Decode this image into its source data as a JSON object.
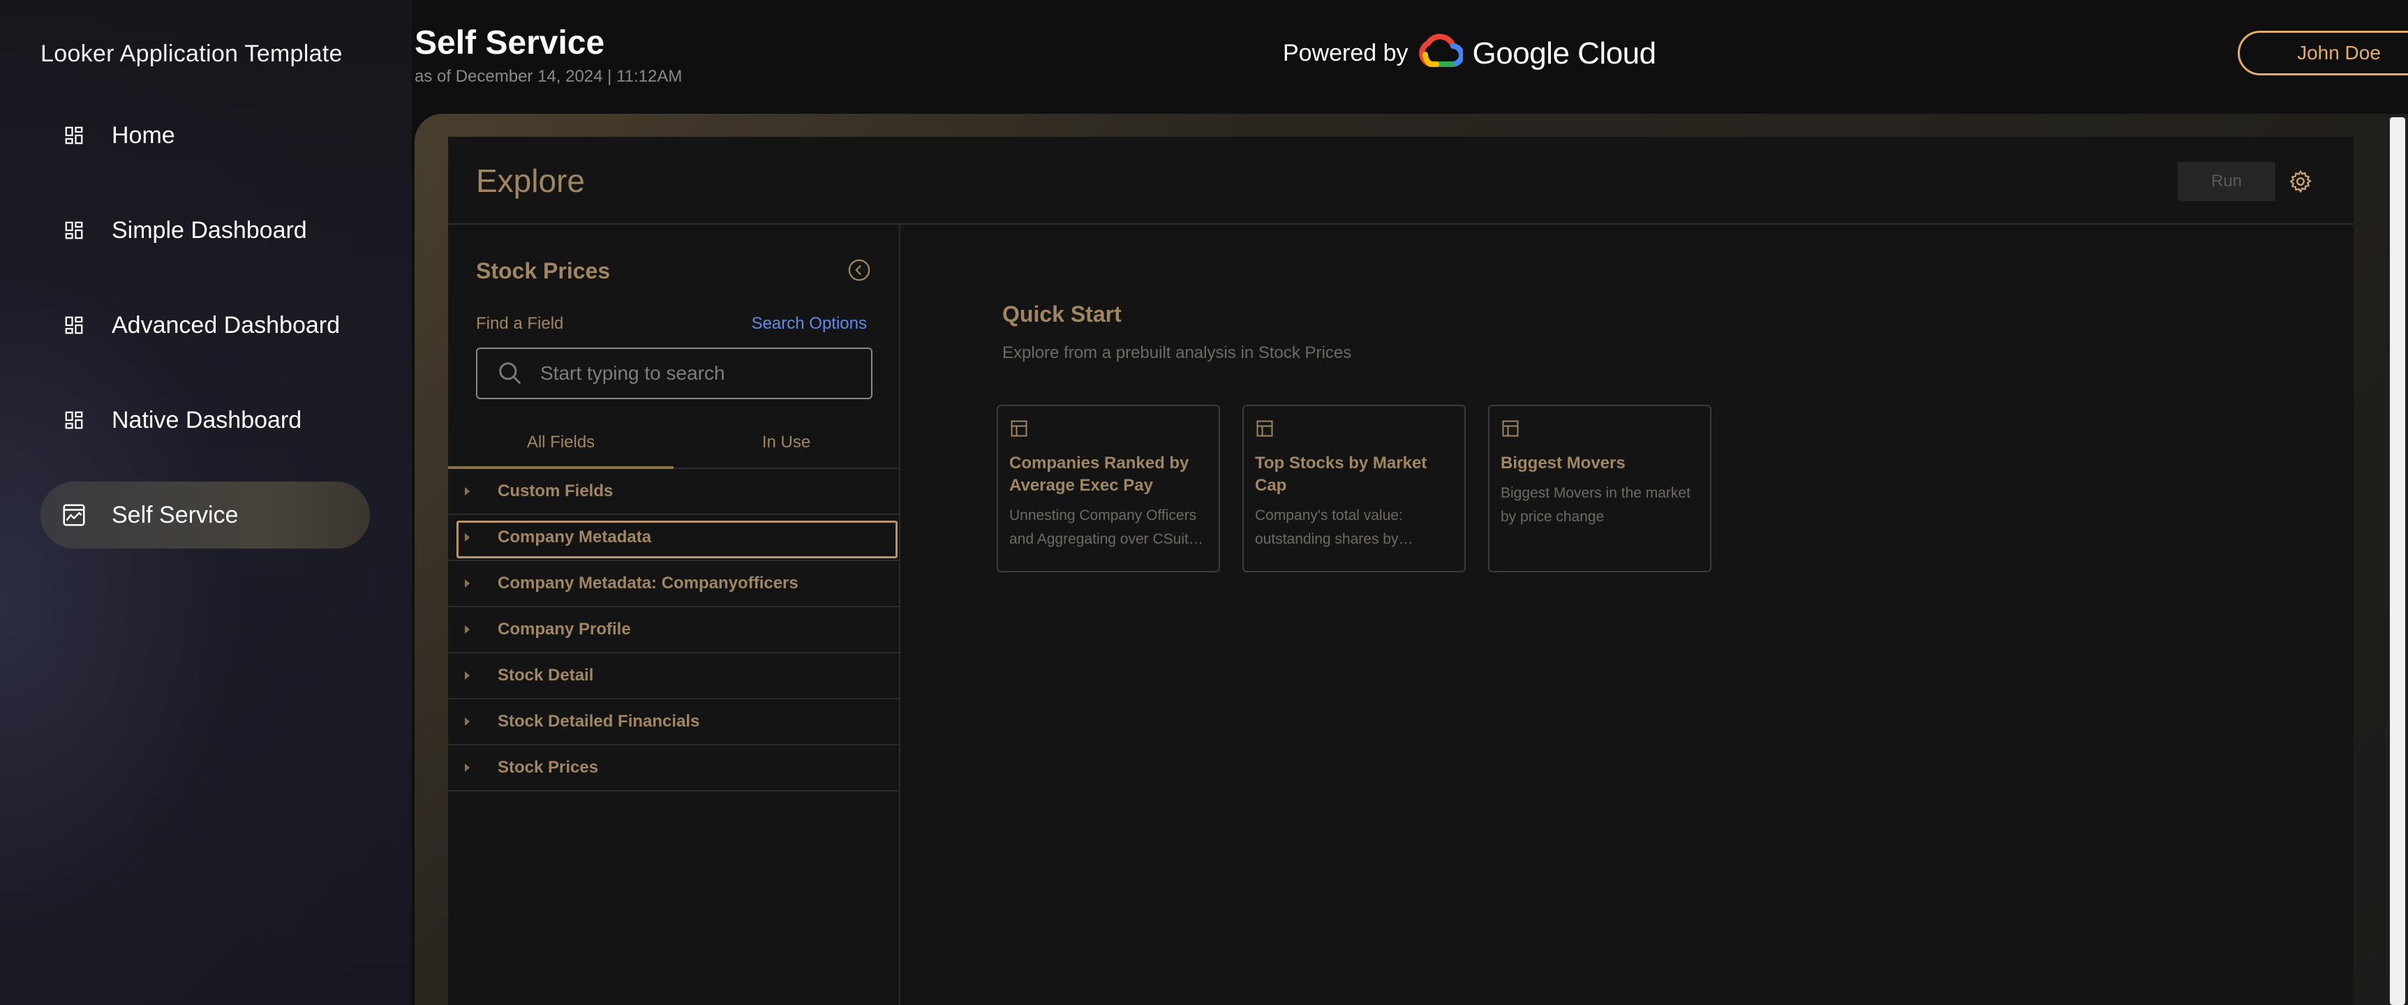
{
  "sidebar": {
    "app_title": "Looker Application Template",
    "items": [
      {
        "label": "Home",
        "icon": "dashboard-icon"
      },
      {
        "label": "Simple Dashboard",
        "icon": "dashboard-icon"
      },
      {
        "label": "Advanced Dashboard",
        "icon": "dashboard-icon"
      },
      {
        "label": "Native Dashboard",
        "icon": "dashboard-icon"
      },
      {
        "label": "Self Service",
        "icon": "analytics-icon",
        "active": true
      }
    ]
  },
  "header": {
    "title": "Self Service",
    "subtitle": "as of December 14, 2024 | 11:12AM",
    "powered_by": "Powered by",
    "brand": "Google Cloud",
    "user_button": "John Doe"
  },
  "explore": {
    "title": "Explore",
    "run_label": "Run",
    "panel": {
      "title": "Stock Prices",
      "find_label": "Find a Field",
      "search_options": "Search Options",
      "search_placeholder": "Start typing to search",
      "tabs": [
        "All Fields",
        "In Use"
      ],
      "fields": [
        "Custom Fields",
        "Company Metadata",
        "Company Metadata: Companyofficers",
        "Company Profile",
        "Stock Detail",
        "Stock Detailed Financials",
        "Stock Prices"
      ]
    },
    "quick_start": {
      "title": "Quick Start",
      "subtitle": "Explore from a prebuilt analysis in Stock Prices",
      "cards": [
        {
          "title": "Companies Ranked by Average Exec Pay",
          "desc": "Unnesting Company Officers and Aggregating over CSuit…"
        },
        {
          "title": "Top Stocks by Market Cap",
          "desc": "Company's total value: outstanding shares by…"
        },
        {
          "title": "Biggest Movers",
          "desc": "Biggest Movers in the market by price change"
        }
      ]
    }
  },
  "colors": {
    "accent": "#e3ad6e",
    "muted_gold": "#a08662",
    "link_blue": "#5b8de8"
  }
}
